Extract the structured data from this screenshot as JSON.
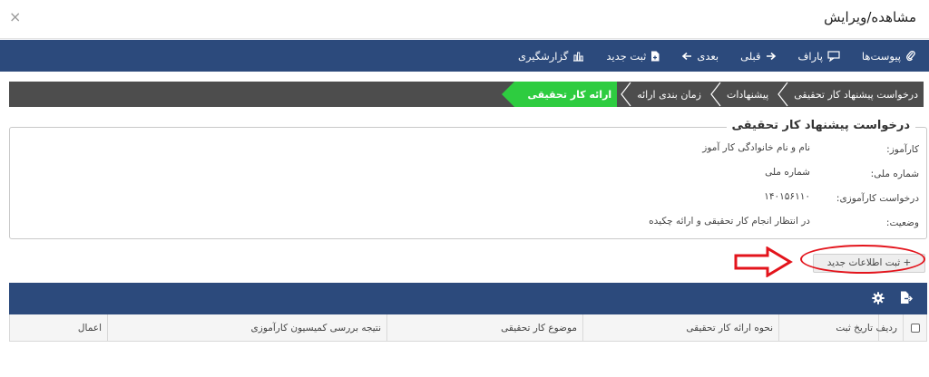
{
  "window": {
    "title": "مشاهده/ویرایش",
    "close_glyph": "×"
  },
  "toolbar": {
    "items": [
      {
        "label": "پیوست‌ها",
        "icon": "paperclip-icon"
      },
      {
        "label": "پاراف",
        "icon": "comment-icon"
      },
      {
        "label": "قبلی",
        "icon": "arrow-right-icon"
      },
      {
        "label": "بعدی",
        "icon": "arrow-left-icon"
      },
      {
        "label": "ثبت جدید",
        "icon": "new-file-icon"
      },
      {
        "label": "گزارشگیری",
        "icon": "bar-chart-icon"
      }
    ]
  },
  "breadcrumb": {
    "items": [
      "درخواست پیشنهاد کار تحقیقی",
      "پیشنهادات",
      "زمان بندی ارائه",
      "ارائه کار تحقیقی"
    ],
    "active_index": 3
  },
  "request_panel": {
    "legend": "درخواست پیشنهاد کار تحقیقی",
    "fields": [
      {
        "label": "کارآموز:",
        "value": "نام و نام خانوادگی کار آموز"
      },
      {
        "label": "شماره ملی:",
        "value": "شماره ملی"
      },
      {
        "label": "درخواست کارآموزی:",
        "value": "۱۴۰۱۵۶۱۱۰"
      },
      {
        "label": "وضعیت:",
        "value": "در انتظار انجام کار تحقیقی و ارائه چکیده"
      }
    ]
  },
  "add_button": {
    "label": "+ ثبت اطلاعات جدید"
  },
  "grid": {
    "toolbar_icons": [
      "export-icon",
      "gear-icon"
    ],
    "columns": [
      "ردیف",
      "تاریخ ثبت",
      "نحوه ارائه کار تحقیقی",
      "موضوع کار تحقیقی",
      "نتیجه بررسی کمیسیون کارآموزی",
      "اعمال"
    ]
  },
  "colors": {
    "toolbar_bg": "#2c4a7c",
    "breadcrumb_bg": "#4d4d4d",
    "breadcrumb_active": "#2ecc40",
    "annotation_red": "#e3141c"
  }
}
